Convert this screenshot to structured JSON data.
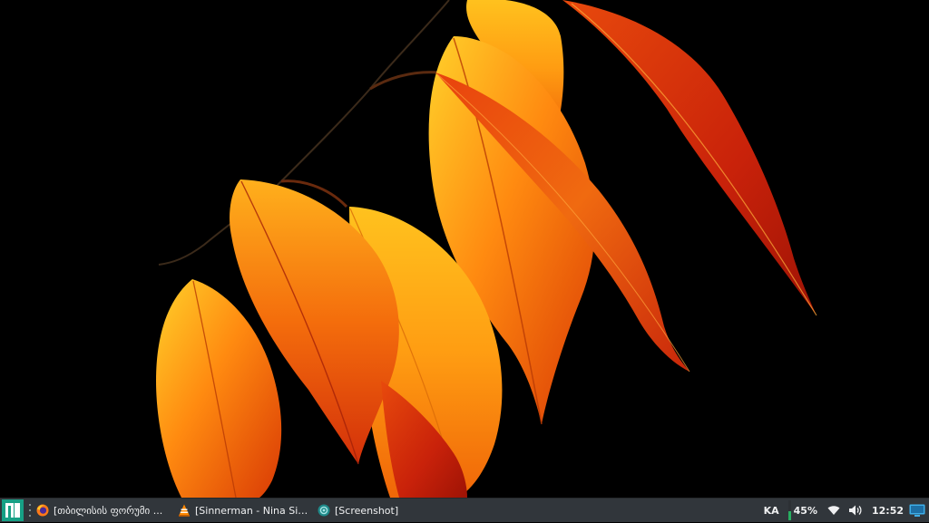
{
  "desktop": {
    "wallpaper_name": "autumn-leaves",
    "background_color": "#000000"
  },
  "panel": {
    "background_color": "#31363b",
    "launcher_icon": "manjaro-logo-icon",
    "launcher_color": "#16a085",
    "tasks": [
      {
        "label": "[თბილისის ფორუმი ...",
        "icon": "firefox-icon"
      },
      {
        "label": "[Sinnerman - Nina Sim...",
        "icon": "vlc-icon"
      },
      {
        "label": "[Screenshot]",
        "icon": "screenshot-icon"
      }
    ],
    "tray": {
      "keyboard_layout": "KA",
      "battery_percent_label": "45%",
      "battery_level": 0.45,
      "battery_color": "#27ae60",
      "network_icon": "wifi-icon",
      "volume_icon": "volume-icon",
      "clock": "12:52",
      "show_desktop_icon": "show-desktop-icon"
    }
  }
}
